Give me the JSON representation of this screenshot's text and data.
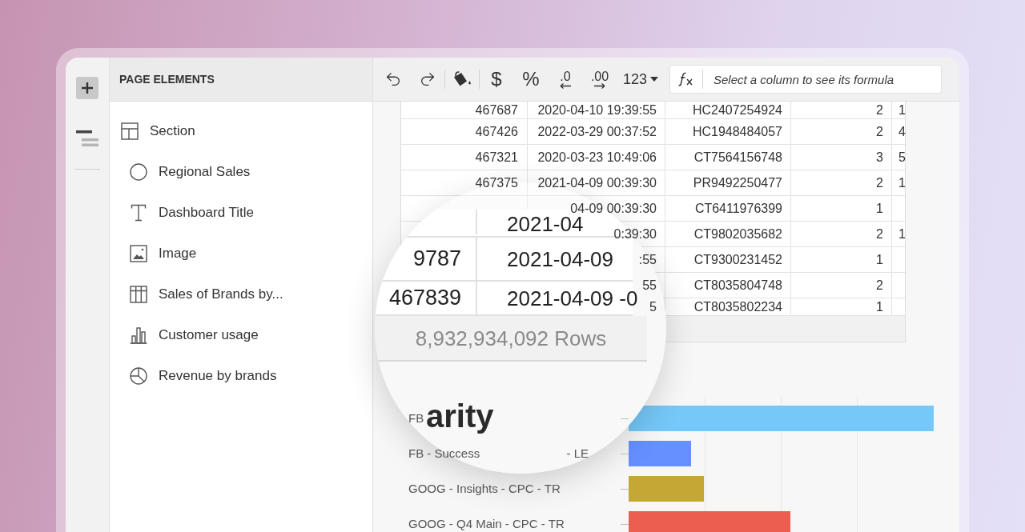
{
  "page_elements": {
    "title": "PAGE ELEMENTS",
    "items": [
      {
        "label": "Section",
        "kind": "section",
        "children": [
          {
            "label": "Regional Sales",
            "kind": "control"
          },
          {
            "label": "Dashboard Title",
            "kind": "text"
          },
          {
            "label": "Image",
            "kind": "image"
          },
          {
            "label": "Sales of Brands by...",
            "kind": "table"
          },
          {
            "label": "Customer usage",
            "kind": "bar_chart"
          },
          {
            "label": "Revenue by brands",
            "kind": "pie_chart"
          }
        ]
      }
    ]
  },
  "toolbar": {
    "groups": [
      [
        {
          "kind": "undo"
        },
        {
          "kind": "redo"
        }
      ],
      [
        {
          "kind": "fill_color"
        }
      ],
      [
        {
          "kind": "currency",
          "label": "$"
        },
        {
          "kind": "percent",
          "label": "%"
        },
        {
          "kind": "decrease_decimals",
          "label": ".0"
        },
        {
          "kind": "increase_decimals",
          "label": ".00"
        },
        {
          "kind": "number_format",
          "label": "123"
        }
      ]
    ],
    "formula": {
      "placeholder": "Select a column to see its formula"
    }
  },
  "table": {
    "rows": [
      {
        "cells": [
          "467687",
          "2020-04-10 19:39:55",
          "HC2407254924",
          "2",
          "1"
        ]
      },
      {
        "cells": [
          "467426",
          "2022-03-29 00:37:52",
          "HC1948484057",
          "2",
          "4"
        ]
      },
      {
        "cells": [
          "467321",
          "2020-03-23 10:49:06",
          "CT7564156748",
          "3",
          "5"
        ]
      },
      {
        "cells": [
          "467375",
          "2021-04-09 00:39:30",
          "PR9492250477",
          "2",
          "1"
        ]
      },
      {
        "cells": [
          null,
          "04-09 00:39:30",
          "CT6411976399",
          "1",
          null
        ]
      },
      {
        "cells": [
          null,
          "0:39:30",
          "CT9802035682",
          "2",
          "1"
        ]
      },
      {
        "cells": [
          null,
          ":55",
          "CT9300231452",
          "1",
          null
        ]
      },
      {
        "cells": [
          null,
          "55",
          "CT8035804748",
          "2",
          null
        ]
      },
      {
        "cells": [
          null,
          "5",
          "CT8035802234",
          "1",
          null
        ]
      }
    ]
  },
  "magnifier": {
    "rows": [
      {
        "cells": [
          null,
          "2021-04"
        ]
      },
      {
        "cells": [
          "9787",
          "2021-04-09"
        ]
      },
      {
        "cells": [
          "467839",
          "2021-04-09 -0"
        ]
      }
    ],
    "row_count": "8,932,934,092 Rows",
    "chart_title": "arity"
  },
  "chart": {
    "bars": [
      {
        "label_parts": [
          "FB"
        ],
        "color": "#76c8f9"
      },
      {
        "label_parts": [
          "FB - Success",
          "- LE"
        ],
        "color": "#6690ff"
      },
      {
        "label_parts": [
          "GOOG - Insights - CPC - TR"
        ],
        "color": "#c4a735"
      },
      {
        "label_parts": [
          "GOOG - Q4 Main - CPC - TR"
        ],
        "color": "#ec5e4f"
      }
    ]
  }
}
